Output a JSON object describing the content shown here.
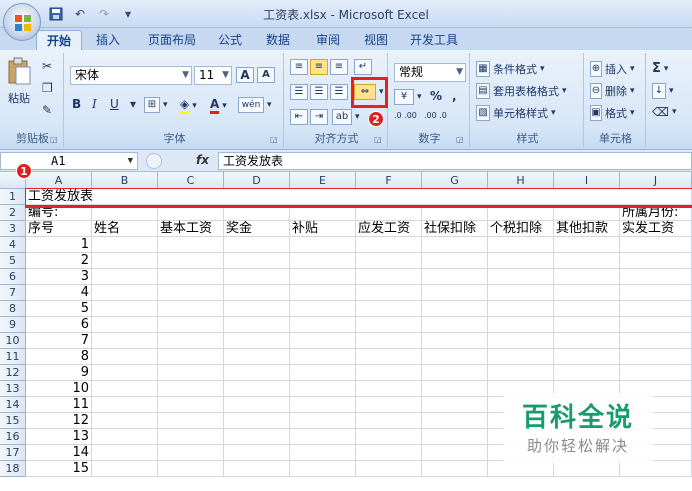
{
  "window": {
    "title": "工资表.xlsx - Microsoft Excel"
  },
  "quick_access": {
    "save_icon": "save-icon",
    "undo_glyph": "↶",
    "redo_glyph": "↷",
    "more_glyph": "▾"
  },
  "tabs": [
    {
      "label": "开始",
      "active": true
    },
    {
      "label": "插入"
    },
    {
      "label": "页面布局"
    },
    {
      "label": "公式"
    },
    {
      "label": "数据"
    },
    {
      "label": "审阅"
    },
    {
      "label": "视图"
    },
    {
      "label": "开发工具"
    }
  ],
  "ribbon": {
    "clipboard": {
      "label": "剪贴板",
      "paste_label": "粘贴"
    },
    "font": {
      "label": "字体",
      "font_name": "宋体",
      "font_size": "11",
      "grow_label": "A",
      "shrink_label": "A",
      "bold": "B",
      "italic": "I",
      "underline": "U",
      "font_color": "A",
      "phonetic": "wén"
    },
    "alignment": {
      "label": "对齐方式"
    },
    "number": {
      "label": "数字",
      "format": "常规",
      "percent": "%",
      "comma": ",",
      "inc_decimal": ".0 .00",
      "dec_decimal": ".00 .0"
    },
    "styles": {
      "label": "样式",
      "conditional": "条件格式",
      "table": "套用表格格式",
      "cell_styles": "单元格样式"
    },
    "cells": {
      "label": "单元格",
      "insert": "插入",
      "delete": "删除",
      "format": "格式"
    },
    "editing": {
      "sum": "Σ"
    }
  },
  "formula_bar": {
    "name_box": "A1",
    "fx": "fx",
    "content": "工资发放表"
  },
  "columns": [
    "A",
    "B",
    "C",
    "D",
    "E",
    "F",
    "G",
    "H",
    "I",
    "J"
  ],
  "rows": [
    {
      "n": "1",
      "cells": {
        "A": "工资发放表"
      }
    },
    {
      "n": "2",
      "cells": {
        "A": "编号:",
        "J": "所属月份:"
      }
    },
    {
      "n": "3",
      "cells": {
        "A": "序号",
        "B": "姓名",
        "C": "基本工资",
        "D": "奖金",
        "E": "补贴",
        "F": "应发工资",
        "G": "社保扣除",
        "H": "个税扣除",
        "I": "其他扣款",
        "J": "实发工资"
      }
    },
    {
      "n": "4",
      "cells": {
        "A": "1"
      }
    },
    {
      "n": "5",
      "cells": {
        "A": "2"
      }
    },
    {
      "n": "6",
      "cells": {
        "A": "3"
      }
    },
    {
      "n": "7",
      "cells": {
        "A": "4"
      }
    },
    {
      "n": "8",
      "cells": {
        "A": "5"
      }
    },
    {
      "n": "9",
      "cells": {
        "A": "6"
      }
    },
    {
      "n": "10",
      "cells": {
        "A": "7"
      }
    },
    {
      "n": "11",
      "cells": {
        "A": "8"
      }
    },
    {
      "n": "12",
      "cells": {
        "A": "9"
      }
    },
    {
      "n": "13",
      "cells": {
        "A": "10"
      }
    },
    {
      "n": "14",
      "cells": {
        "A": "11"
      }
    },
    {
      "n": "15",
      "cells": {
        "A": "12"
      }
    },
    {
      "n": "16",
      "cells": {
        "A": "13"
      }
    },
    {
      "n": "17",
      "cells": {
        "A": "14"
      }
    },
    {
      "n": "18",
      "cells": {
        "A": "15"
      }
    }
  ],
  "annotations": {
    "step1": "1",
    "step2": "2",
    "color": "#e52222"
  },
  "watermark": {
    "title": "百科全说",
    "subtitle": "助你轻松解决",
    "color": "#1a9b6c"
  }
}
